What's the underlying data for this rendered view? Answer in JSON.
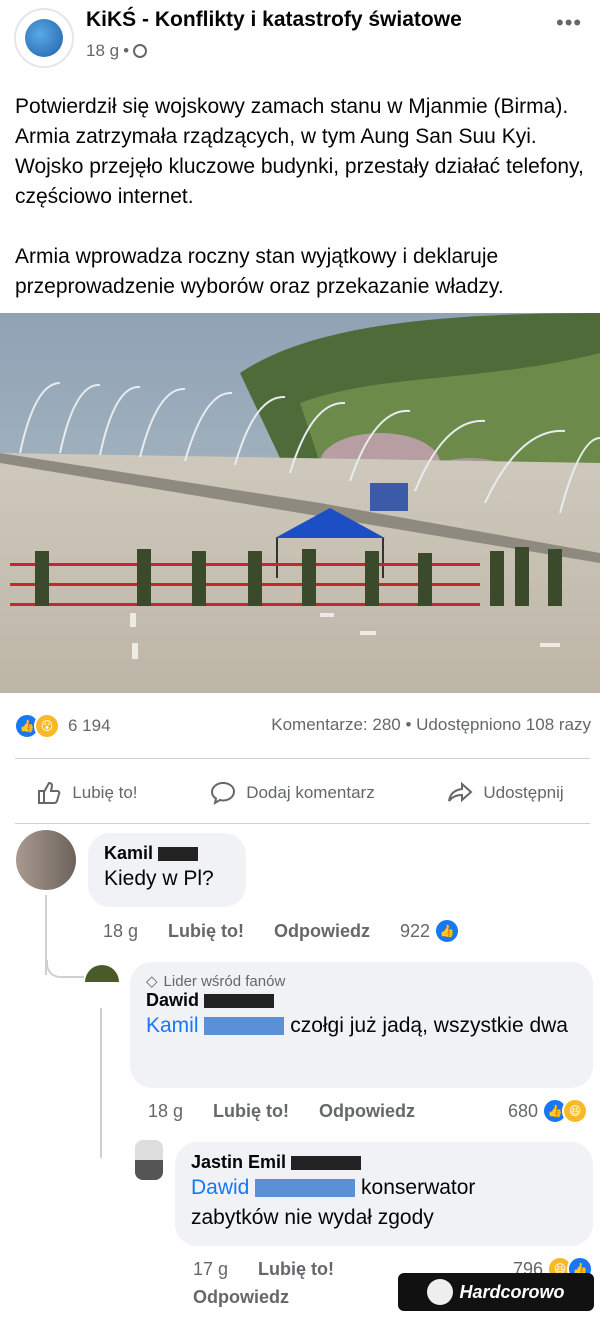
{
  "post": {
    "page_name": "KiKŚ - Konflikty i katastrofy światowe",
    "time": "18 g",
    "paragraphs": [
      "Potwierdził się wojskowy zamach stanu w Mjanmie (Birma). Armia zatrzymała rządzących, w tym Aung San Suu Kyi. Wojsko przejęło kluczowe budynki, przestały działać telefony, częściowo internet.",
      "Armia wprowadza roczny stan wyjątkowy i deklaruje przeprowadzenie wyborów oraz przekazanie władzy."
    ]
  },
  "stats": {
    "reactions": "6 194",
    "comments": "Komentarze: 280",
    "shares": "Udostępniono 108 razy"
  },
  "actions": {
    "like": "Lubię to!",
    "comment": "Dodaj komentarz",
    "share": "Udostępnij"
  },
  "comments": [
    {
      "author": "Kamil",
      "text": "Kiedy w Pl?",
      "time": "18 g",
      "like": "Lubię to!",
      "reply": "Odpowiedz",
      "reactions": "922"
    },
    {
      "badge": "Lider wśród fanów",
      "author": "Dawid",
      "mention": "Kamil",
      "text": "czołgi już jadą, wszystkie dwa",
      "time": "18 g",
      "like": "Lubię to!",
      "reply": "Odpowiedz",
      "reactions": "680"
    },
    {
      "author": "Jastin Emil",
      "mention": "Dawid",
      "text_line1": "konserwator",
      "text_line2": "zabytków nie wydał zgody",
      "time": "17 g",
      "like": "Lubię to!",
      "reply": "Odpowiedz",
      "reactions": "796"
    }
  ],
  "watermark": "Hardcorowo",
  "colors": {
    "accent": "#1877f2",
    "meta": "#65676b",
    "bubble": "#f0f2f5"
  }
}
